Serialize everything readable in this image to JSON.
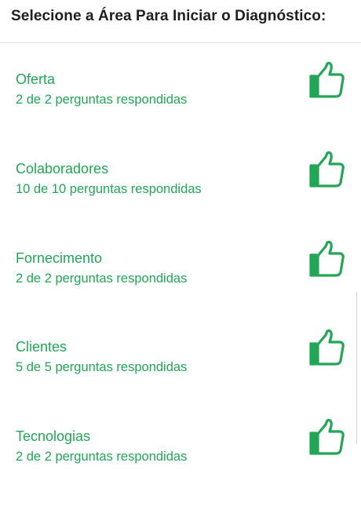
{
  "header": {
    "title": "Selecione a Área Para Iniciar o Diagnóstico:"
  },
  "areas": [
    {
      "name": "Oferta",
      "progress": "2 de 2 perguntas respondidas",
      "status_icon": "thumbs-up-icon"
    },
    {
      "name": "Colaboradores",
      "progress": "10 de 10 perguntas respondidas",
      "status_icon": "thumbs-up-icon"
    },
    {
      "name": "Fornecimento",
      "progress": "2 de 2 perguntas respondidas",
      "status_icon": "thumbs-up-icon"
    },
    {
      "name": "Clientes",
      "progress": "5 de 5 perguntas respondidas",
      "status_icon": "thumbs-up-icon"
    },
    {
      "name": "Tecnologias",
      "progress": "2 de 2 perguntas respondidas",
      "status_icon": "thumbs-up-icon"
    }
  ],
  "colors": {
    "accent": "#22a655",
    "title": "#212121",
    "divider": "#e2e2e2"
  }
}
